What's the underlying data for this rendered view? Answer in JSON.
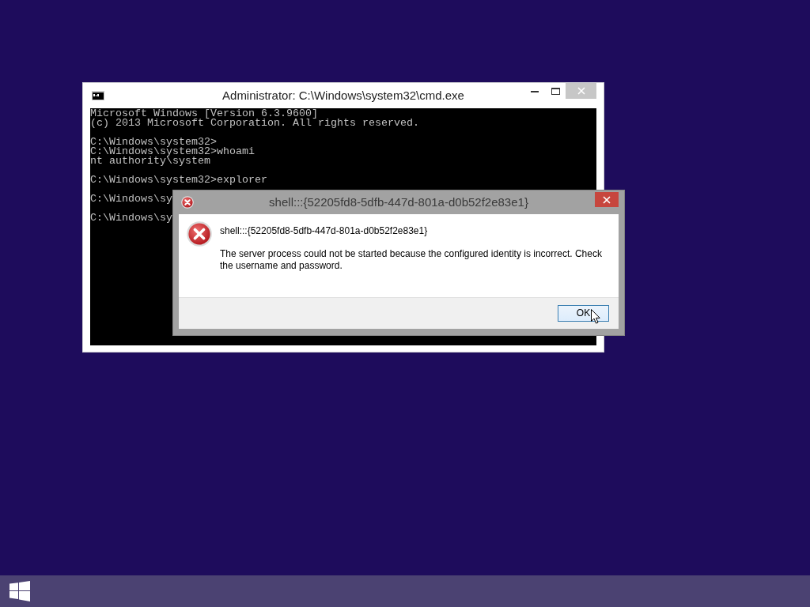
{
  "console_window": {
    "title": "Administrator: C:\\Windows\\system32\\cmd.exe",
    "output_blocks": [
      [
        "Microsoft Windows [Version 6.3.9600]",
        "(c) 2013 Microsoft Corporation. All rights reserved."
      ],
      [
        "C:\\Windows\\system32>",
        "C:\\Windows\\system32>whoami",
        "nt authority\\system"
      ],
      [
        "C:\\Windows\\system32>explorer"
      ],
      [
        "C:\\Windows\\sy"
      ],
      [
        "C:\\Windows\\sy"
      ]
    ]
  },
  "error_dialog": {
    "title": "shell:::{52205fd8-5dfb-447d-801a-d0b52f2e83e1}",
    "heading": "shell:::{52205fd8-5dfb-447d-801a-d0b52f2e83e1}",
    "message": "The server process could not be started because the configured identity is incorrect. Check the username and password.",
    "buttons": [
      {
        "label": "OK",
        "default": true
      }
    ]
  }
}
